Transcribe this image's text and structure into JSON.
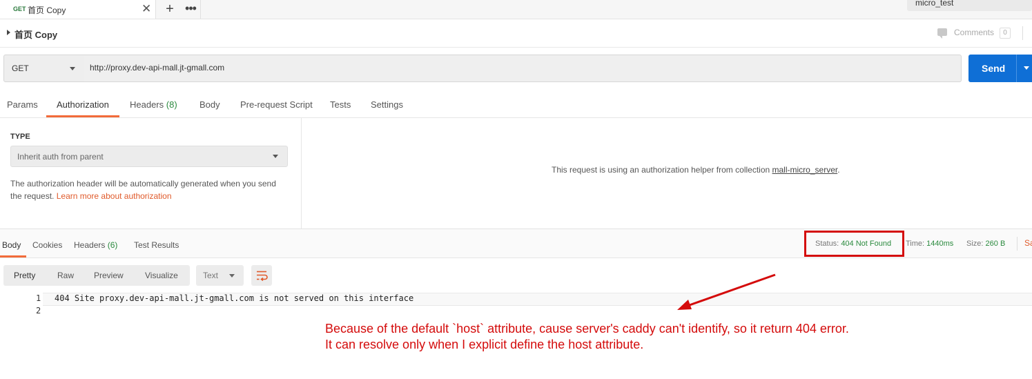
{
  "tab": {
    "method": "GET",
    "name": "首页 Copy",
    "close": "✕",
    "add": "+",
    "more": "•••"
  },
  "environment": {
    "name": "micro_test"
  },
  "breadcrumb": {
    "title": "首页 Copy"
  },
  "comments": {
    "label": "Comments",
    "count": "0"
  },
  "request": {
    "method": "GET",
    "url": "http://proxy.dev-api-mall.jt-gmall.com",
    "send_label": "Send"
  },
  "request_tabs": {
    "params": "Params",
    "authorization": "Authorization",
    "headers": "Headers",
    "headers_count": "(8)",
    "body": "Body",
    "prerequest": "Pre-request Script",
    "tests": "Tests",
    "settings": "Settings"
  },
  "auth": {
    "type_label": "TYPE",
    "type_value": "Inherit auth from parent",
    "help_text": "The authorization header will be automatically generated when you send the request.",
    "help_link": "Learn more about authorization",
    "message_prefix": "This request is using an authorization helper from collection",
    "collection_name": "mall-micro_server",
    "message_suffix": "."
  },
  "response_tabs": {
    "body": "Body",
    "cookies": "Cookies",
    "headers": "Headers",
    "headers_count": "(6)",
    "test_results": "Test Results"
  },
  "response_stats": {
    "status_label": "Status:",
    "status_value": "404 Not Found",
    "time_label": "Time:",
    "time_value": "1440ms",
    "size_label": "Size:",
    "size_value": "260 B",
    "save_label": "Sa"
  },
  "view_modes": {
    "pretty": "Pretty",
    "raw": "Raw",
    "preview": "Preview",
    "visualize": "Visualize",
    "format": "Text"
  },
  "response_body": {
    "line_numbers": [
      "1",
      "2"
    ],
    "line1": "404 Site proxy.dev-api-mall.jt-gmall.com is not served on this interface"
  },
  "annotation": {
    "line1": "Because of the default `host` attribute, cause server's caddy can't identify, so it return 404 error.",
    "line2": "It can resolve only when I explicit define the host attribute."
  },
  "colors": {
    "accent": "#f26b3a",
    "send": "#0f6fd6",
    "success": "#2b8a3e",
    "annotation": "#d40b0b"
  }
}
